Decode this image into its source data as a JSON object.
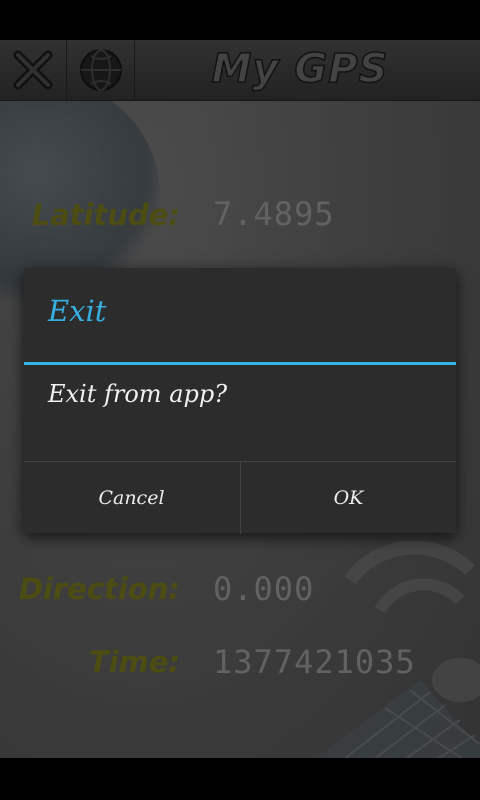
{
  "app": {
    "title": "My GPS"
  },
  "fields": [
    {
      "label": "Latitude:",
      "value": "7.4895"
    },
    {
      "label": "Direction:",
      "value": "0.000"
    },
    {
      "label": "Time:",
      "value": "1377421035"
    }
  ],
  "dialog": {
    "title": "Exit",
    "message": "Exit from app?",
    "cancel_label": "Cancel",
    "ok_label": "OK"
  },
  "colors": {
    "accent": "#33b5e5",
    "label": "#8c8a22",
    "value": "#b3b3b3",
    "dialog_bg": "#2c2c2c"
  },
  "icons": {
    "close": "close-icon",
    "globe": "globe-icon"
  }
}
